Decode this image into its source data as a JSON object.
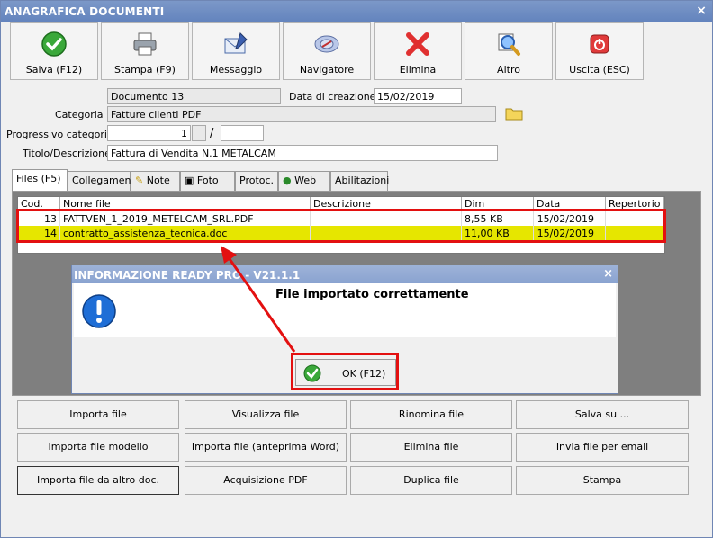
{
  "window": {
    "title": "ANAGRAFICA DOCUMENTI",
    "close": "×"
  },
  "toolbar": [
    {
      "label": "Salva (F12)",
      "icon": "check-icon"
    },
    {
      "label": "Stampa (F9)",
      "icon": "printer-icon"
    },
    {
      "label": "Messaggio",
      "icon": "message-icon"
    },
    {
      "label": "Navigatore",
      "icon": "compass-icon"
    },
    {
      "label": "Elimina",
      "icon": "delete-x-icon"
    },
    {
      "label": "Altro",
      "icon": "magnifier-icon"
    },
    {
      "label": "Uscita (ESC)",
      "icon": "power-icon"
    }
  ],
  "form": {
    "documento": "Documento 13",
    "data_label": "Data di creazione :",
    "data_value": "15/02/2019",
    "categoria_label": "Categoria :",
    "categoria_value": "Fatture clienti PDF",
    "progressivo_label": "Progressivo categoria :",
    "progressivo_value": "1",
    "progressivo_sep": "/",
    "progressivo_value2": "",
    "titolo_label": "Titolo/Descrizione :",
    "titolo_value": "Fattura di Vendita N.1 METALCAM"
  },
  "tabs": [
    "Files (F5)",
    "Collegamenti",
    "Note",
    "Foto",
    "Protoc.",
    "Web",
    "Abilitazioni"
  ],
  "grid": {
    "headers": [
      "Cod.",
      "Nome file",
      "Descrizione",
      "Dim",
      "Data",
      "Repertorio"
    ],
    "rows": [
      {
        "cod": "13",
        "nome": "FATTVEN_1_2019_METELCAM_SRL.PDF",
        "descrizione": "",
        "dim": "8,55 KB",
        "data": "15/02/2019",
        "repertorio": ""
      },
      {
        "cod": "14",
        "nome": "contratto_assistenza_tecnica.doc",
        "descrizione": "",
        "dim": "11,00 KB",
        "data": "15/02/2019",
        "repertorio": ""
      }
    ]
  },
  "dialog": {
    "title": "INFORMAZIONE READY PRO - V21.1.1",
    "message": "File importato correttamente",
    "ok_label": "OK (F12)"
  },
  "bottom_buttons": [
    [
      "Importa file",
      "Visualizza file",
      "Rinomina file",
      "Salva su ..."
    ],
    [
      "Importa file modello",
      "Importa file (anteprima Word)",
      "Elimina file",
      "Invia file per email"
    ],
    [
      "Importa file da altro doc.",
      "Acquisizione PDF",
      "Duplica file",
      "Stampa"
    ]
  ],
  "colors": {
    "titlebar": "#6283bd",
    "highlight_row": "#e6e600",
    "annotation_red": "#e31010"
  }
}
